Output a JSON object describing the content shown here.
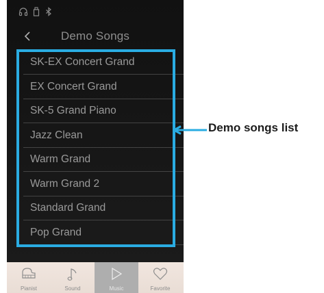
{
  "status_bar": {
    "icons": [
      "headphones-icon",
      "usb-icon",
      "bluetooth-icon"
    ],
    "icon_color": "#8a8a8a"
  },
  "nav": {
    "back_icon": "chevron-left-icon",
    "title": "Demo Songs"
  },
  "demo_songs": [
    {
      "label": "SK-EX Concert Grand"
    },
    {
      "label": "EX Concert Grand"
    },
    {
      "label": "SK-5 Grand Piano"
    },
    {
      "label": "Jazz Clean"
    },
    {
      "label": "Warm Grand"
    },
    {
      "label": "Warm Grand 2"
    },
    {
      "label": "Standard Grand"
    },
    {
      "label": "Pop Grand"
    }
  ],
  "tabs": [
    {
      "label": "Pianist",
      "icon": "piano-icon",
      "active": false
    },
    {
      "label": "Sound",
      "icon": "music-note-icon",
      "active": false
    },
    {
      "label": "Music",
      "icon": "play-icon",
      "active": true
    },
    {
      "label": "Favorite",
      "icon": "heart-icon",
      "active": false
    }
  ],
  "callout": {
    "label": "Demo songs list",
    "color": "#2aace2"
  },
  "colors": {
    "highlight": "#2aace2",
    "tabbar_background": "#efe4dd",
    "active_tab": "#aeaeae"
  }
}
